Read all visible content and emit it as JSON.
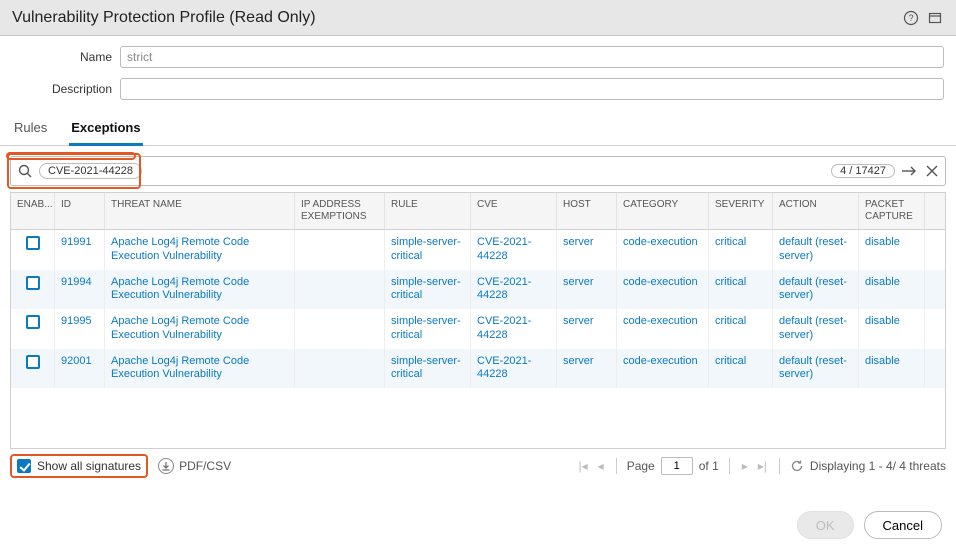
{
  "window": {
    "title": "Vulnerability Protection Profile (Read Only)"
  },
  "form": {
    "name_label": "Name",
    "name_value": "strict",
    "desc_label": "Description",
    "desc_value": ""
  },
  "tabs": {
    "rules": "Rules",
    "exceptions": "Exceptions"
  },
  "search": {
    "query": "CVE-2021-44228",
    "result_count": "4 / 17427"
  },
  "columns": {
    "enable": "ENAB...",
    "id": "ID",
    "threat_name": "THREAT NAME",
    "ip_exemptions": "IP ADDRESS EXEMPTIONS",
    "rule": "RULE",
    "cve": "CVE",
    "host": "HOST",
    "category": "CATEGORY",
    "severity": "SEVERITY",
    "action": "ACTION",
    "packet_capture": "PACKET CAPTURE"
  },
  "rows": [
    {
      "id": "91991",
      "threat": "Apache Log4j Remote Code Execution Vulnerability",
      "rule": "simple-server-critical",
      "cve": "CVE-2021-44228",
      "host": "server",
      "category": "code-execution",
      "severity": "critical",
      "action": "default (reset-server)",
      "pcap": "disable"
    },
    {
      "id": "91994",
      "threat": "Apache Log4j Remote Code Execution Vulnerability",
      "rule": "simple-server-critical",
      "cve": "CVE-2021-44228",
      "host": "server",
      "category": "code-execution",
      "severity": "critical",
      "action": "default (reset-server)",
      "pcap": "disable"
    },
    {
      "id": "91995",
      "threat": "Apache Log4j Remote Code Execution Vulnerability",
      "rule": "simple-server-critical",
      "cve": "CVE-2021-44228",
      "host": "server",
      "category": "code-execution",
      "severity": "critical",
      "action": "default (reset-server)",
      "pcap": "disable"
    },
    {
      "id": "92001",
      "threat": "Apache Log4j Remote Code Execution Vulnerability",
      "rule": "simple-server-critical",
      "cve": "CVE-2021-44228",
      "host": "server",
      "category": "code-execution",
      "severity": "critical",
      "action": "default (reset-server)",
      "pcap": "disable"
    }
  ],
  "footer": {
    "show_all_label": "Show all signatures",
    "pdfcsv_label": "PDF/CSV",
    "page_label": "Page",
    "page_value": "1",
    "of_label": "of 1",
    "displaying": "Displaying 1 - 4/ 4 threats"
  },
  "buttons": {
    "ok": "OK",
    "cancel": "Cancel"
  }
}
